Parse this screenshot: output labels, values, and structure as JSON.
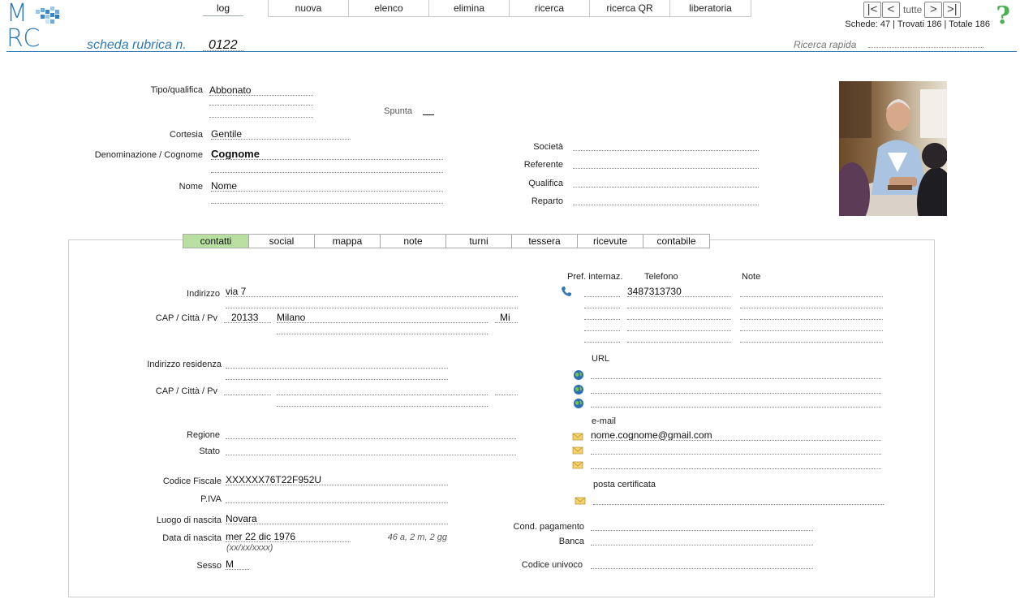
{
  "logo": {
    "line1": "M",
    "line2": "RC"
  },
  "nav": {
    "log": "log",
    "tabs": [
      "nuova",
      "elenco",
      "elimina",
      "ricerca",
      "ricerca QR",
      "liberatoria"
    ]
  },
  "pager": {
    "first": "|<",
    "prev": "<",
    "all": "tutte",
    "next": ">",
    "last": ">|"
  },
  "counts": "Schede: 47 | Trovati 186 | Totale 186",
  "help": "?",
  "title": {
    "label": "scheda rubrica n.",
    "number": "0122"
  },
  "quick_search": {
    "label": "Ricerca rapida",
    "value": ""
  },
  "anag": {
    "tipo_label": "Tipo/qualifica",
    "tipo_value": "Abbonato",
    "spunta_label": "Spunta",
    "spunta_value": "",
    "cortesia_label": "Cortesia",
    "cortesia_value": "Gentile",
    "denominazione_label": "Denominazione / Cognome",
    "denominazione_value": "Cognome",
    "nome_label": "Nome",
    "nome_value": "Nome",
    "societa_label": "Società",
    "referente_label": "Referente",
    "qualifica_label": "Qualifica",
    "reparto_label": "Reparto"
  },
  "subtabs": [
    "contatti",
    "social",
    "mappa",
    "note",
    "turni",
    "tessera",
    "ricevute",
    "contabile"
  ],
  "contatti": {
    "indirizzo_label": "Indirizzo",
    "indirizzo_value": "via  7",
    "cap_label": "CAP  / Città  / Pv",
    "cap_value": "20133",
    "citta_value": "Milano",
    "pv_value": "Mi",
    "indirizzo_res_label": "Indirizzo residenza",
    "cap_res_label": "CAP / Città / Pv",
    "regione_label": "Regione",
    "stato_label": "Stato",
    "cf_label": "Codice Fiscale",
    "cf_value": "XXXXXX76T22F952U",
    "piva_label": "P.IVA",
    "luogo_label": "Luogo di nascita",
    "luogo_value": "Novara",
    "data_label": "Data di nascita",
    "data_value": "mer 22 dic 1976",
    "data_format": "(xx/xx/xxxx)",
    "eta": "46 a, 2 m, 2 gg",
    "sesso_label": "Sesso",
    "sesso_value": "M",
    "pref_label": "Pref. internaz.",
    "tel_label": "Telefono",
    "note_label": "Note",
    "tel_value": "3487313730",
    "url_label": "URL",
    "email_label": "e-mail",
    "email_value": "nome.cognome@gmail.com",
    "pec_label": "posta certificata",
    "cond_pag_label": "Cond. pagamento",
    "banca_label": "Banca",
    "codice_univoco_label": "Codice univoco"
  },
  "colors": {
    "accent": "#2f79b5",
    "active_tab": "#b8dea0",
    "help": "#4caf50"
  },
  "icons": {
    "phone": "phone-icon",
    "globe": "globe-icon",
    "mail": "mail-icon"
  }
}
